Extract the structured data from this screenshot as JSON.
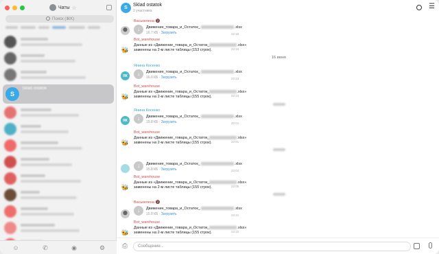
{
  "sidebar": {
    "title": "Чаты",
    "search_placeholder": "Поиск (⌘K)",
    "active_chat": {
      "avatar_letter": "S"
    }
  },
  "header": {
    "avatar_letter": "S",
    "title": "Sklad ostatok",
    "subtitle": "2 участника"
  },
  "messages": [
    {
      "sender": "Васькелена 🔞",
      "file": "Движение_товара_и_Остаток_",
      "ext": ".xlsx",
      "size": "16.7 КБ",
      "download": "Загрузить",
      "time": "22:15"
    },
    {
      "sender": "Bot_warehouse",
      "text1": "Данные из «Движение_товара_и_Остаток_",
      "text1_end": ".xlsx»",
      "text2": "заменены на 2-м листе таблицы (153 строк).",
      "time": "22:16"
    },
    {
      "date": "16 июня"
    },
    {
      "sender": "Янина Косенко",
      "avatar": "ЯК",
      "file": "Движение_товара_и_Остаток_",
      "ext": ".xlsx",
      "size": "16.0 КБ",
      "download": "Загрузить",
      "time": "22:24"
    },
    {
      "sender": "Bot_warehouse",
      "text1": "Данные из «Движение_товара_и_Остаток_",
      "text1_end": ".xlsx»",
      "text2": "заменены на 2-м листе таблицы (155 строк).",
      "time": "22:24"
    },
    {
      "sender": "Янина Косенко",
      "avatar": "ЯК",
      "file": "Движение_товара_и_Остаток_",
      "ext": ".xlsx",
      "size": "15.8 КБ",
      "download": "Загрузить",
      "time": "22:01"
    },
    {
      "sender": "Bot_warehouse",
      "text1": "Данные из «Движение_товара_и_Остаток_",
      "text1_end": ".xlsx»",
      "text2": "заменены на 2-м листе таблицы (155 строк).",
      "time": "22:01"
    },
    {
      "file": "Движение_товара_и_Остаток_",
      "ext": ".xlsx",
      "size": "15.8 КБ",
      "download": "Загрузить",
      "time": "22:04"
    },
    {
      "sender": "Bot_warehouse",
      "text1": "Данные из «Движение_товара_и_Остаток_",
      "text1_end": ".xlsx»",
      "text2": "заменены на 2-м листе таблицы (155 строк).",
      "time": "22:05"
    },
    {
      "sender": "Васькелена 🔞",
      "file": "Движение_товара_и_Остаток_",
      "ext": ".xlsx",
      "size": "15.0 КБ",
      "download": "Загрузить",
      "time": "22:21"
    },
    {
      "sender": "Bot_warehouse",
      "text1": "Данные из «Движение_товара_и_Остаток_",
      "text1_end": ".xlsx»",
      "text2": "заменены на 2-м листе таблицы (155 строк).",
      "time": "22:22"
    }
  ],
  "composer": {
    "placeholder": "Сообщение..."
  }
}
